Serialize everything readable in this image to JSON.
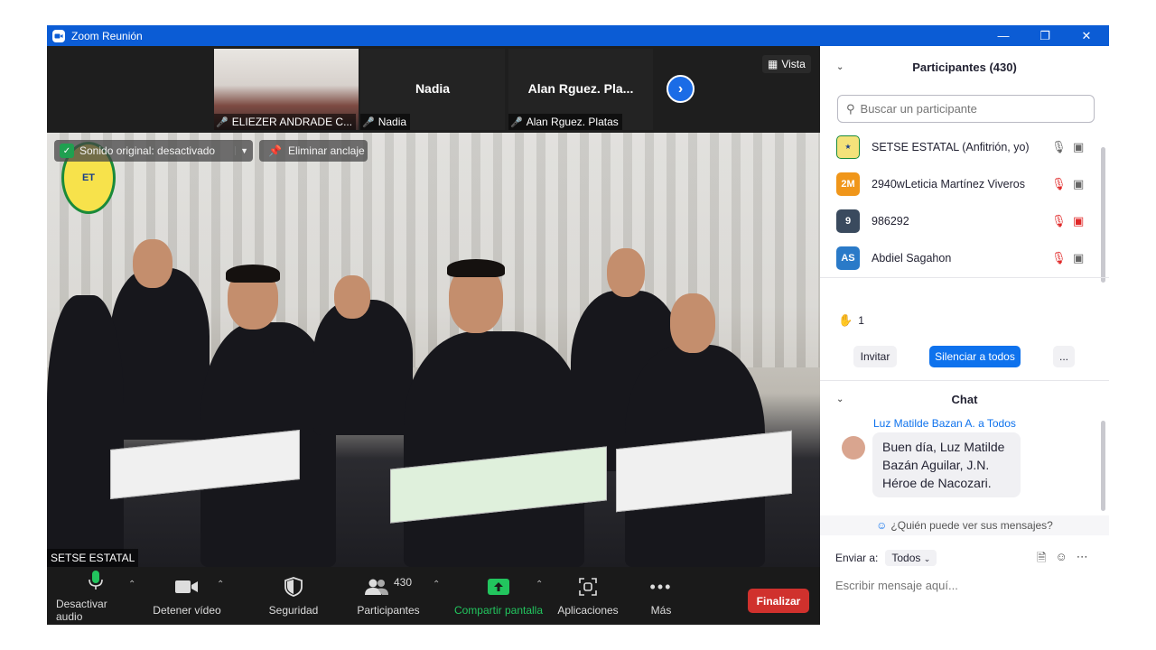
{
  "window": {
    "title": "Zoom Reunión",
    "minimize_icon": "minimize-icon",
    "restore_icon": "restore-icon",
    "close_icon": "close-icon"
  },
  "strip": {
    "tiles": [
      {
        "caption": "ELIEZER ANDRADE C...",
        "big": ""
      },
      {
        "caption": "Nadia",
        "big": "Nadia"
      },
      {
        "caption": "Alan  Rguez. Platas",
        "big": "Alan  Rguez. Pla..."
      }
    ],
    "view_label": "Vista"
  },
  "main_video": {
    "sound_badge": "Sonido original: desactivado",
    "unpin_label": "Eliminar anclaje",
    "logo_text": "ET",
    "name_tag": "SETSE ESTATAL"
  },
  "toolbar": {
    "audio": "Desactivar audio",
    "video": "Detener vídeo",
    "security": "Seguridad",
    "participants": "Participantes",
    "participants_count": "430",
    "share": "Compartir pantalla",
    "apps": "Aplicaciones",
    "more": "Más",
    "end": "Finalizar"
  },
  "participants_panel": {
    "title": "Participantes (430)",
    "search_placeholder": "Buscar un participante",
    "items": [
      {
        "initials": "",
        "name": "SETSE ESTATAL (Anfitrión, yo)",
        "color": "#f4e27a",
        "muted": false,
        "cam_off": false
      },
      {
        "initials": "2M",
        "name": "2940wLeticia Martínez Viveros",
        "color": "#f0961a",
        "muted": true,
        "cam_off": false
      },
      {
        "initials": "9",
        "name": "986292",
        "color": "#3a4a5e",
        "muted": true,
        "cam_off": true
      },
      {
        "initials": "AS",
        "name": "Abdiel Sagahon",
        "color": "#2a7ac8",
        "muted": true,
        "cam_off": false
      }
    ],
    "reaction_count": "1",
    "invite": "Invitar",
    "mute_all": "Silenciar a todos",
    "more_btn": "..."
  },
  "chat": {
    "title": "Chat",
    "from": "Luz Matilde Bazan A. a Todos",
    "message": "Buen día, Luz Matilde Bazán Aguilar, J.N. Héroe de Nacozari.",
    "who_can_see": "¿Quién puede ver sus mensajes?",
    "send_to_label": "Enviar a:",
    "send_to_value": "Todos",
    "input_placeholder": "Escribir mensaje aquí..."
  },
  "colors": {
    "accent": "#0e72ed",
    "end": "#d0312d",
    "share": "#22c55e"
  }
}
